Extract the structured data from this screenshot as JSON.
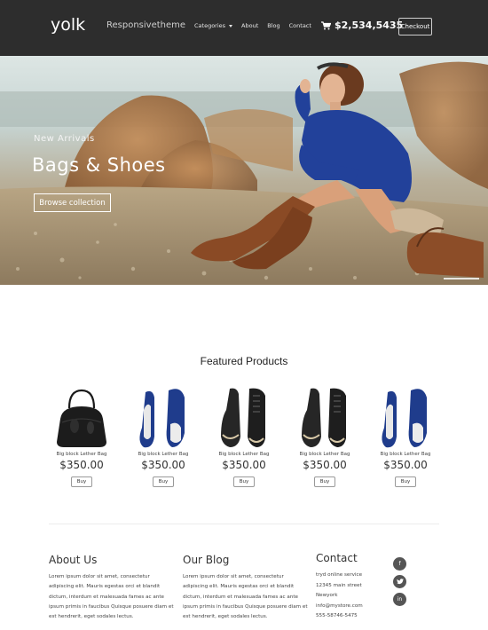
{
  "header": {
    "logo": "yolk",
    "tagline": "Responsivetheme",
    "nav": [
      {
        "label": "Categories",
        "has_dropdown": true
      },
      {
        "label": "About"
      },
      {
        "label": "Blog"
      },
      {
        "label": "Contact"
      }
    ],
    "cart_total": "$2,534,5435",
    "checkout_label": "Checkout"
  },
  "hero": {
    "subtitle": "New Arrivals",
    "title": "Bags & Shoes",
    "button_label": "Browse collection"
  },
  "featured": {
    "title": "Featured Products",
    "products": [
      {
        "name": "Big block Lether Bag",
        "price": "$350.00",
        "buy_label": "Buy",
        "image": "black-handbag"
      },
      {
        "name": "Big block Lether Bag",
        "price": "$350.00",
        "buy_label": "Buy",
        "image": "blue-loafers"
      },
      {
        "name": "Big block Lether Bag",
        "price": "$350.00",
        "buy_label": "Buy",
        "image": "black-high-top-sneakers"
      },
      {
        "name": "Big block Lether Bag",
        "price": "$350.00",
        "buy_label": "Buy",
        "image": "black-high-top-sneakers"
      },
      {
        "name": "Big block Lether Bag",
        "price": "$350.00",
        "buy_label": "Buy",
        "image": "blue-loafers"
      }
    ]
  },
  "footer": {
    "about": {
      "heading": "About Us",
      "text": "Lorem ipsum dolor sit amet, consectetur adipiscing elit. Mauris egestas orci et blandit dictum, interdum et malesuada fames ac ante ipsum primis in faucibus Quisque posuere diam et est hendrerit, eget sodales lectus."
    },
    "blog": {
      "heading": "Our Blog",
      "text": "Lorem ipsum dolor sit amet, consectetur adipiscing elit. Mauris egestas orci et blandit dictum, interdum et malesuada fames ac ante ipsum primis in faucibus Quisque posuere diam et est hendrerit, eget sodales lectus."
    },
    "contact": {
      "heading": "Contact",
      "lines": [
        "tryd online service",
        "12345 main street",
        "Newyork",
        "info@mystore.com",
        "555-58746-5475"
      ]
    },
    "social": [
      {
        "icon": "facebook-icon",
        "glyph": "f"
      },
      {
        "icon": "twitter-icon",
        "glyph": "🐦"
      },
      {
        "icon": "linkedin-icon",
        "glyph": "in"
      }
    ]
  },
  "colors": {
    "header_bg": "#2d2d2d",
    "accent_blue": "#1f3c8c",
    "sweater_blue": "#22419a"
  }
}
